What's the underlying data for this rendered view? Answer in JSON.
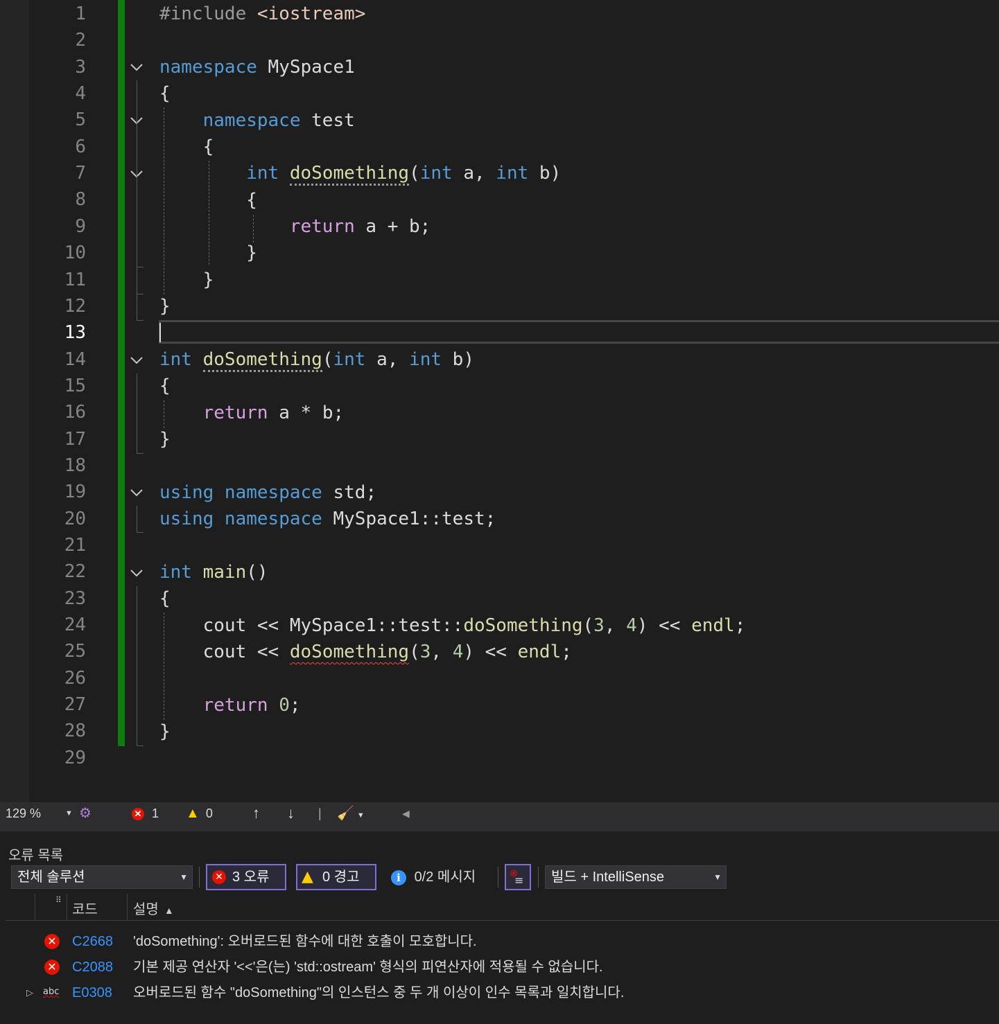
{
  "editor": {
    "line_numbers": [
      "1",
      "2",
      "3",
      "4",
      "5",
      "6",
      "7",
      "8",
      "9",
      "10",
      "11",
      "12",
      "13",
      "14",
      "15",
      "16",
      "17",
      "18",
      "19",
      "20",
      "21",
      "22",
      "23",
      "24",
      "25",
      "26",
      "27",
      "28",
      "29"
    ],
    "current_line": "13",
    "lines": {
      "l1_a": "#include ",
      "l1_b": "<iostream>",
      "l3_a": "namespace",
      "l3_b": " MySpace1",
      "l4": "{",
      "l5_a": "    namespace",
      "l5_b": " test",
      "l6": "    {",
      "l7_ind": "        ",
      "l7_int1": "int",
      "l7_sp": " ",
      "l7_fn": "doSomething",
      "l7_p1": "(",
      "l7_int2": "int",
      "l7_a": " a, ",
      "l7_int3": "int",
      "l7_b": " b)",
      "l8": "        {",
      "l9_ind": "            ",
      "l9_ret": "return",
      "l9_rest": " a + b;",
      "l10": "        }",
      "l11": "    }",
      "l12": "}",
      "l14_int1": "int",
      "l14_sp": " ",
      "l14_fn": "doSomething",
      "l14_p1": "(",
      "l14_int2": "int",
      "l14_a": " a, ",
      "l14_int3": "int",
      "l14_b": " b)",
      "l15": "{",
      "l16_ind": "    ",
      "l16_ret": "return",
      "l16_rest": " a * b;",
      "l17": "}",
      "l19_using": "using",
      "l19_ns": " namespace",
      "l19_rest": " std;",
      "l20_using": "using",
      "l20_ns": " namespace",
      "l20_rest": " MySpace1::test;",
      "l22_int": "int",
      "l22_sp": " ",
      "l22_fn": "main",
      "l22_rest": "()",
      "l23": "{",
      "l24_ind": "    ",
      "l24_cout": "cout",
      "l24_op": " << MySpace1::test::",
      "l24_fn": "doSomething",
      "l24_p": "(",
      "l24_n1": "3",
      "l24_c": ", ",
      "l24_n2": "4",
      "l24_p2": ") << ",
      "l24_endl": "endl",
      "l24_semi": ";",
      "l25_ind": "    ",
      "l25_cout": "cout",
      "l25_op": " << ",
      "l25_fn": "doSomething",
      "l25_p": "(",
      "l25_n1": "3",
      "l25_c": ", ",
      "l25_n2": "4",
      "l25_p2": ") << ",
      "l25_endl": "endl",
      "l25_semi": ";",
      "l27_ind": "    ",
      "l27_ret": "return",
      "l27_sp": " ",
      "l27_n": "0",
      "l27_semi": ";",
      "l28": "}"
    }
  },
  "status_bar": {
    "zoom": "129 %",
    "error_count": "1",
    "warning_count": "0"
  },
  "error_list": {
    "title": "오류 목록",
    "scope": "전체 솔루션",
    "errors_toggle": "3 오류",
    "warnings_toggle": "0 경고",
    "messages": "0/2 메시지",
    "source_filter": "빌드 + IntelliSense",
    "col_code": "코드",
    "col_desc": "설명",
    "rows": [
      {
        "code": "C2668",
        "desc": "'doSomething': 오버로드된 함수에 대한 호출이 모호합니다."
      },
      {
        "code": "C2088",
        "desc": "기본 제공 연산자 '<<'은(는) 'std::ostream' 형식의 피연산자에 적용될 수 없습니다."
      },
      {
        "code": "E0308",
        "desc": "오버로드된 함수 \"doSomething\"의 인스턴스 중 두 개 이상이 인수 목록과 일치합니다."
      }
    ]
  },
  "colors": {
    "keyword": "#569cd6",
    "control": "#d8a0df",
    "function": "#dcdcaa",
    "number": "#b5cea8",
    "error": "#e51400",
    "change_bar": "#107c10"
  }
}
